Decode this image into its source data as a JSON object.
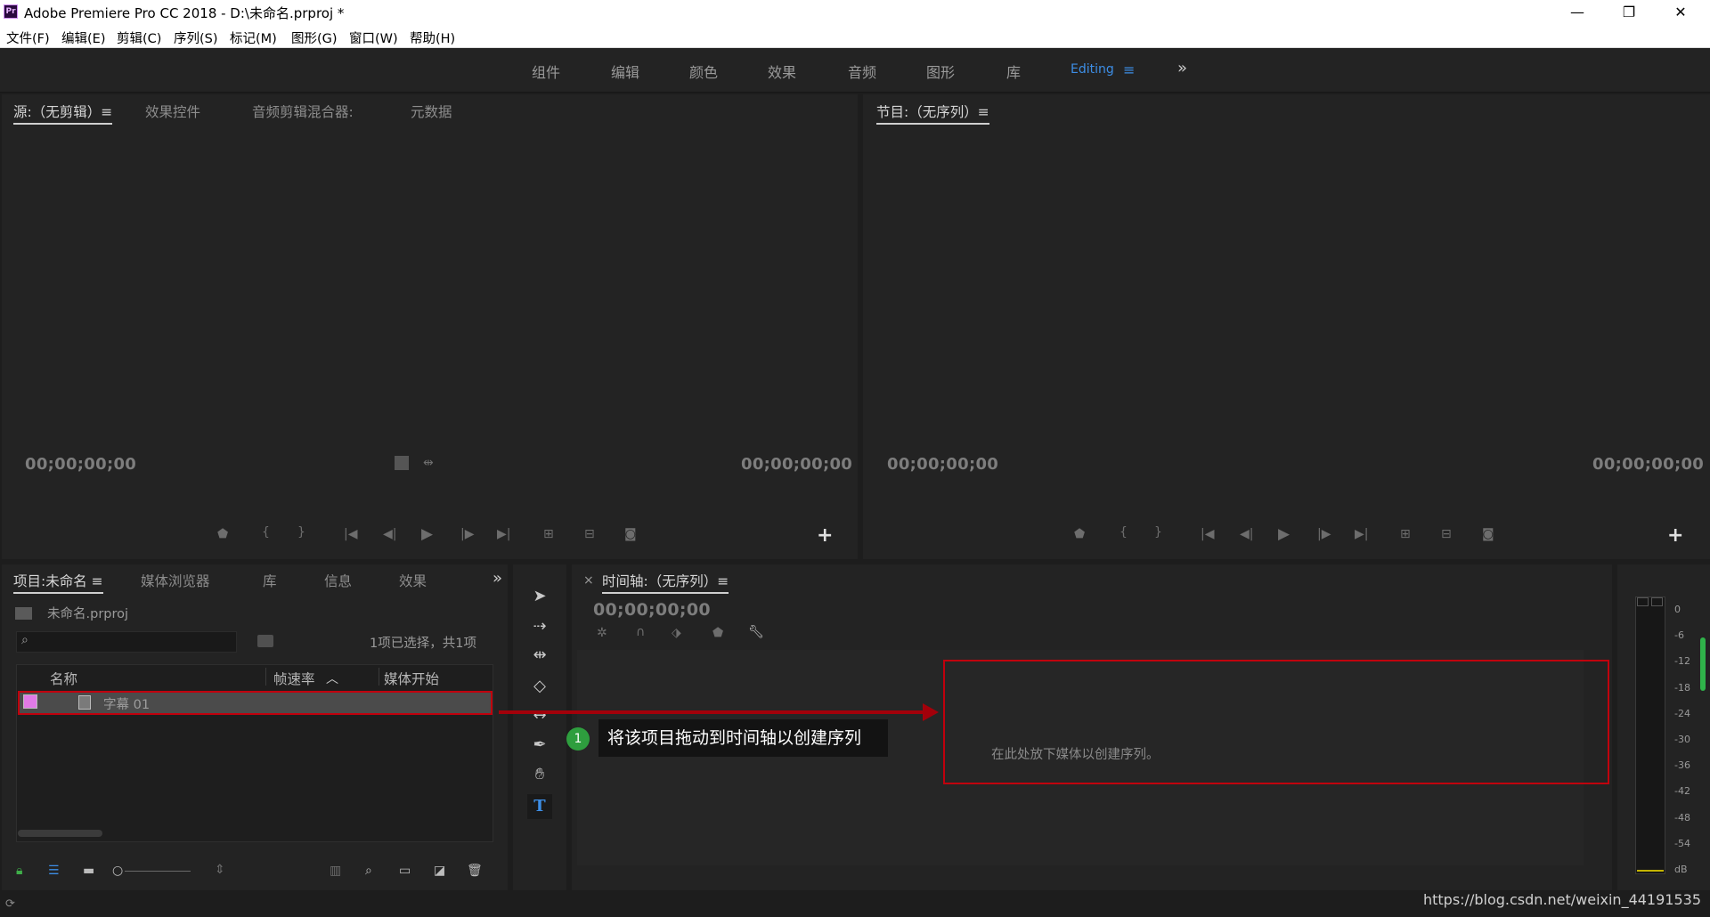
{
  "window": {
    "app_icon_label": "Pr",
    "title": "Adobe Premiere Pro CC 2018 - D:\\未命名.prproj *",
    "minimize_glyph": "—",
    "restore_glyph": "❐",
    "close_glyph": "✕"
  },
  "menubar": [
    "文件(F)",
    "编辑(E)",
    "剪辑(C)",
    "序列(S)",
    "标记(M)",
    "图形(G)",
    "窗口(W)",
    "帮助(H)"
  ],
  "workspaces": {
    "items": [
      "组件",
      "编辑",
      "颜色",
      "效果",
      "音频",
      "图形",
      "库"
    ],
    "active": "Editing",
    "active_menu": "≡",
    "more": "»"
  },
  "source_panel": {
    "tabs": [
      "源:（无剪辑）≡",
      "效果控件",
      "音频剪辑混合器:",
      "元数据"
    ],
    "timecode_left": "00;00;00;00",
    "timecode_right": "00;00;00;00",
    "add_button": "+"
  },
  "program_panel": {
    "tab": "节目:（无序列）≡",
    "timecode_left": "00;00;00;00",
    "timecode_right": "00;00;00;00",
    "add_button": "+"
  },
  "project_panel": {
    "tabs": [
      "项目:未命名 ≡",
      "媒体浏览器",
      "库",
      "信息",
      "效果"
    ],
    "more": "»",
    "project_file": "未命名.prproj",
    "search_placeholder": "",
    "selection_status": "1项已选择，共1项",
    "columns": [
      "名称",
      "帧速率",
      "媒体开始"
    ],
    "sort_indicator": "︿",
    "items": [
      {
        "name": "字幕 01",
        "swatch_color": "#e07ae6"
      }
    ]
  },
  "timeline_panel": {
    "close": "×",
    "tab": "时间轴:（无序列）≡",
    "timecode": "00;00;00;00",
    "drop_hint": "在此处放下媒体以创建序列。"
  },
  "annotation": {
    "step_number": "1",
    "text": "将该项目拖动到时间轴以创建序列"
  },
  "audio_meter": {
    "labels": [
      "0",
      "-6",
      "-12",
      "-18",
      "-24",
      "-30",
      "-36",
      "-42",
      "-48",
      "-54",
      "dB"
    ]
  },
  "status": {
    "watermark_url": "https://blog.csdn.net/weixin_44191535"
  }
}
